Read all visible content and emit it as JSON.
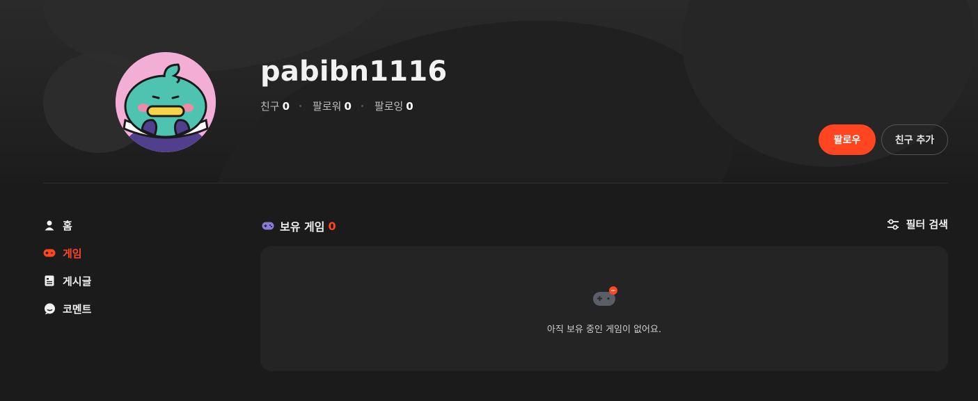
{
  "profile": {
    "username": "pabibn1116",
    "stats": [
      {
        "label": "친구",
        "value": "0"
      },
      {
        "label": "팔로워",
        "value": "0"
      },
      {
        "label": "팔로잉",
        "value": "0"
      }
    ]
  },
  "actions": {
    "follow_label": "팔로우",
    "add_friend_label": "친구 추가"
  },
  "sidebar": {
    "items": [
      {
        "label": "홈",
        "icon": "person-icon",
        "active": false
      },
      {
        "label": "게임",
        "icon": "gamepad-icon",
        "active": true
      },
      {
        "label": "게시글",
        "icon": "document-icon",
        "active": false
      },
      {
        "label": "코멘트",
        "icon": "comment-icon",
        "active": false
      }
    ]
  },
  "main": {
    "section_title": "보유 게임",
    "count": "0",
    "filter_label": "필터 검색",
    "empty_text": "아직 보유 중인 게임이 없어요."
  },
  "colors": {
    "accent": "#ff4621",
    "background": "#1b1b1b",
    "card": "#242424"
  }
}
